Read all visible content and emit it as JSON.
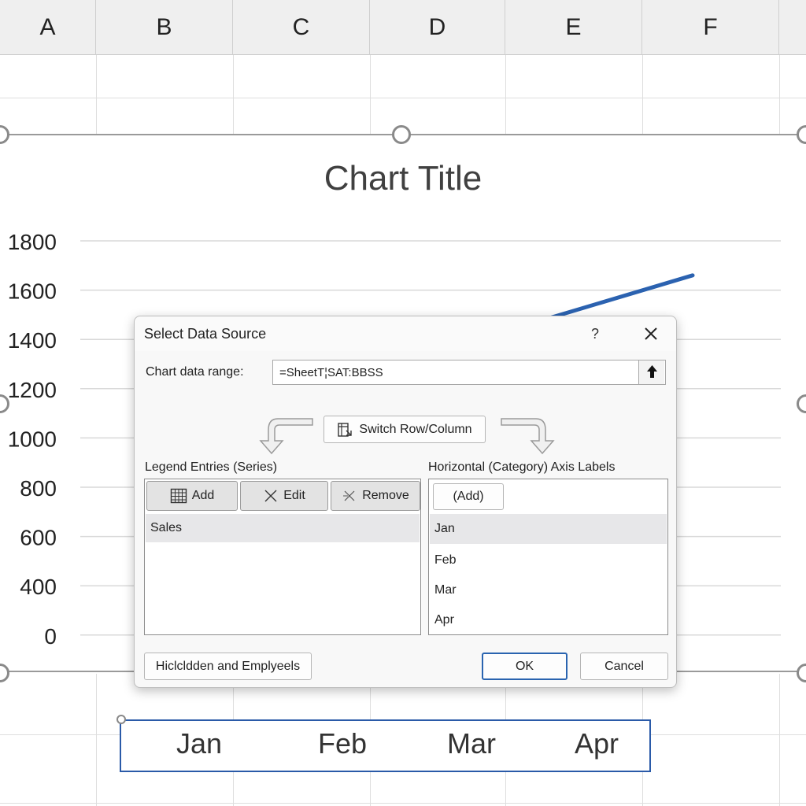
{
  "sheet": {
    "columns": [
      "A",
      "B",
      "C",
      "D",
      "E",
      "F"
    ]
  },
  "chart": {
    "title": "Chart Title",
    "series_color": "#2b62b0",
    "axis_box_color": "#2a5aa8"
  },
  "chart_data": {
    "type": "line",
    "title": "Chart Title",
    "ytick_labels": [
      "1800",
      "1600",
      "1400",
      "1200",
      "1000",
      "800",
      "600",
      "400",
      "0"
    ],
    "categories": [
      "Jan",
      "Feb",
      "Mar",
      "Apr"
    ],
    "series": [
      {
        "name": "Sales",
        "values": [
          null,
          null,
          1460,
          1660
        ]
      }
    ],
    "grid": true
  },
  "dialog": {
    "title": "Select Data Source",
    "help_label": "?",
    "range_label": "Chart data range:",
    "range_value": "=SheetT¦SAT:BBSS",
    "switch_label": "Switch Row/Column",
    "legend_header": "Legend Entries (Series)",
    "legend_buttons": {
      "add": "Add",
      "edit": "Edit",
      "remove": "Remove"
    },
    "series_items": [
      "Sales"
    ],
    "axis_header": "Horizontal (Category) Axis Labels",
    "axis_add": "(Add)",
    "axis_items": [
      "Jan",
      "Feb",
      "Mar",
      "Apr"
    ],
    "hidden_button": "Hiclcldden and Emplyeels",
    "ok": "OK",
    "cancel": "Cancel"
  },
  "category_axis": {
    "labels": [
      "Jan",
      "Feb",
      "Mar",
      "Apr"
    ]
  }
}
